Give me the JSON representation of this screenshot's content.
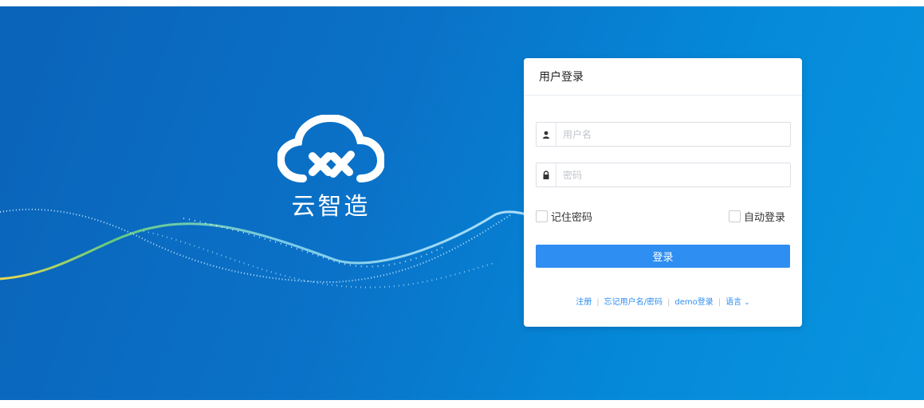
{
  "brand": {
    "name": "云智造"
  },
  "login": {
    "title": "用户登录",
    "username_placeholder": "用户名",
    "password_placeholder": "密码",
    "remember_label": "记住密码",
    "auto_login_label": "自动登录",
    "submit_label": "登录"
  },
  "links": {
    "register": "注册",
    "forgot": "忘记用户名/密码",
    "demo": "demo登录",
    "language": "语言"
  },
  "colors": {
    "primary": "#2e8ef1",
    "background": "#0a72c8"
  }
}
